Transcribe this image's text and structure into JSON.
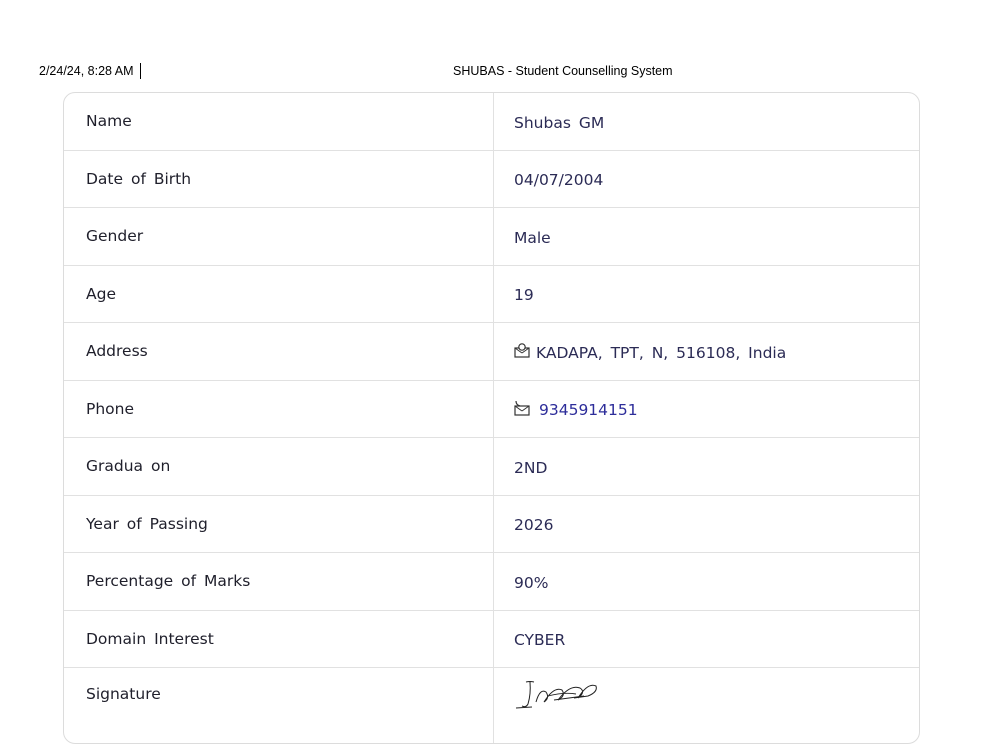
{
  "print_header": {
    "datetime": "2/24/24, 8:28 AM",
    "title": "SHUBAS - Student Counselling System"
  },
  "details": {
    "rows": [
      {
        "label": "Name",
        "value": "Shubas GM"
      },
      {
        "label": "Date of Birth",
        "value": "04/07/2004"
      },
      {
        "label": "Gender",
        "value": "Male"
      },
      {
        "label": "Age",
        "value": "19"
      },
      {
        "label": "Address",
        "value": "KADAPA, TPT, N, 516108, India",
        "icon": "location-icon"
      },
      {
        "label": "Phone",
        "value": "9345914151",
        "icon": "phone-icon"
      },
      {
        "label": "Gradua on",
        "value": "2ND"
      },
      {
        "label": "Year of Passing",
        "value": "2026"
      },
      {
        "label": "Percentage of Marks",
        "value": "90%"
      },
      {
        "label": "Domain Interest",
        "value": "CYBER"
      },
      {
        "label": "Signature",
        "value": "",
        "icon": "signature-image"
      }
    ]
  },
  "colors": {
    "label_text": "#1f1f2b",
    "value_text": "#2b2b55",
    "link_text": "#2d2d9a",
    "border": "#e1e1e1"
  }
}
